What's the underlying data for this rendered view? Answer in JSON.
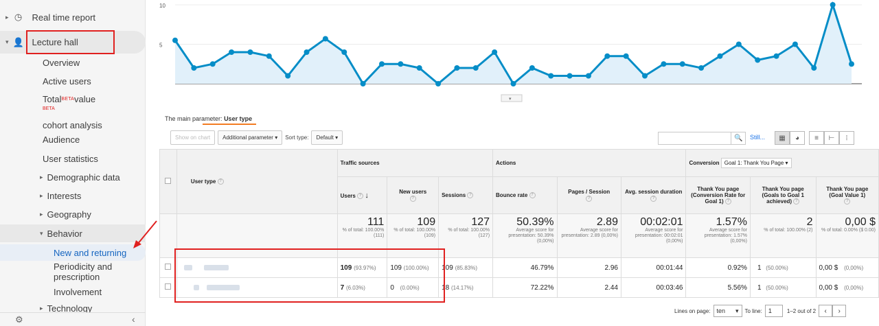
{
  "sidebar": {
    "realtime": "Real time report",
    "lecture": "Lecture hall",
    "items": [
      "Overview",
      "Active users"
    ],
    "total": "Total",
    "beta": "BETA",
    "value": "value",
    "items2": [
      "cohort analysis",
      "Audience",
      "User statistics"
    ],
    "groups": [
      "Demographic data",
      "Interests",
      "Geography"
    ],
    "behavior": "Behavior",
    "beh_items": [
      "New and returning",
      "Periodicity and",
      "prescription",
      "Involvement"
    ],
    "tech": "Technology"
  },
  "chart_data": {
    "type": "area",
    "yticks": [
      "10",
      "5"
    ],
    "values": [
      5.5,
      2,
      2.5,
      4,
      4,
      3.5,
      1,
      4,
      5.7,
      4,
      0,
      2.5,
      2.5,
      2,
      0,
      2,
      2,
      4,
      0,
      2,
      1,
      1,
      1,
      3.5,
      3.5,
      1,
      2.5,
      2.5,
      2,
      3.5,
      5,
      3,
      3.5,
      5,
      2,
      10,
      2.5
    ]
  },
  "params": {
    "label": "The main parameter:",
    "value": "User type"
  },
  "toolbar": {
    "show_chart": "Show on chart",
    "additional": "Additional parameter",
    "sort_label": "Sort type:",
    "sort_value": "Default",
    "still": "Still..."
  },
  "table": {
    "user_type": "User type",
    "traffic": "Traffic sources",
    "actions": "Actions",
    "conversion": "Conversion",
    "goal": "Goal 1: Thank You Page",
    "cols": [
      "Users",
      "New users",
      "Sessions",
      "Bounce rate",
      "Pages / Session",
      "Avg. session duration",
      "Thank You page (Conversion Rate for Goal 1)",
      "Thank You page (Goals to Goal 1 achieved)",
      "Thank You page (Goal Value 1)"
    ],
    "totals": [
      {
        "v": "111",
        "s": "% of total: 100.00% (111)"
      },
      {
        "v": "109",
        "s": "% of total: 100.00% (109)"
      },
      {
        "v": "127",
        "s": "% of total: 100.00% (127)"
      },
      {
        "v": "50.39%",
        "s": "Average score for presentation: 50.39% (0,00%)"
      },
      {
        "v": "2.89",
        "s": "Average score for presentation: 2.89 (0,00%)"
      },
      {
        "v": "00:02:01",
        "s": "Average score for presentation: 00:02:01 (0,00%)"
      },
      {
        "v": "1.57%",
        "s": "Average score for presentation: 1.57% (0,00%)"
      },
      {
        "v": "2",
        "s": "% of total: 100.00% (2)"
      },
      {
        "v": "0,00 $",
        "s": "% of total: 0.00% ($ 0.00)"
      }
    ],
    "rows": [
      {
        "users": "109",
        "users_p": "(93.97%)",
        "new": "109",
        "new_p": "(100.00%)",
        "sess": "109",
        "sess_p": "(85.83%)",
        "bounce": "46.79%",
        "pps": "2.96",
        "dur": "00:01:44",
        "cr": "0.92%",
        "goals": "1",
        "goals_p": "(50.00%)",
        "val": "0,00 $",
        "val_p": "(0,00%)"
      },
      {
        "users": "7",
        "users_p": "(6.03%)",
        "new": "0",
        "new_p": "(0.00%)",
        "sess": "18",
        "sess_p": "(14.17%)",
        "bounce": "72.22%",
        "pps": "2.44",
        "dur": "00:03:46",
        "cr": "5.56%",
        "goals": "1",
        "goals_p": "(50.00%)",
        "val": "0,00 $",
        "val_p": "(0,00%)"
      }
    ]
  },
  "pager": {
    "lines_label": "Lines on page:",
    "lines_value": "ten",
    "to_line": "To line:",
    "to_value": "1",
    "range": "1–2 out of 2"
  }
}
